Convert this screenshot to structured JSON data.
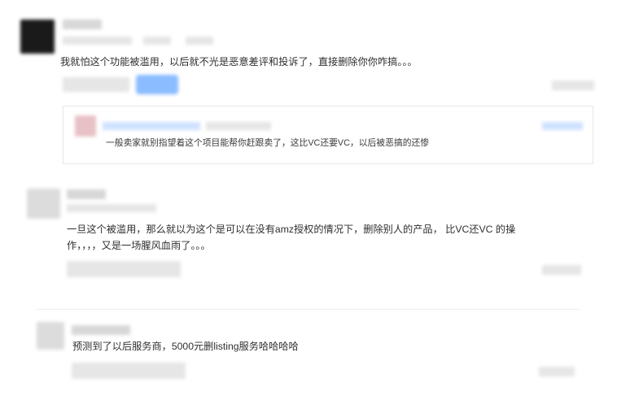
{
  "comments": [
    {
      "text": "我就怕这个功能被滥用，以后就不光是恶意差评和投诉了，直接删除你你咋搞。。。",
      "reply": {
        "text": "一般卖家就别指望着这个项目能帮你赶跟卖了，这比VC还要VC，以后被恶搞的还惨"
      }
    },
    {
      "text_line1": "一旦这个被滥用，那么就以为这个是可以在没有amz授权的情况下，删除别人的产品，  比VC还VC 的操",
      "text_line2": "作，，，，又是一场腥风血雨了。。。"
    },
    {
      "text": "预测到了以后服务商，5000元删listing服务哈哈哈哈"
    }
  ]
}
